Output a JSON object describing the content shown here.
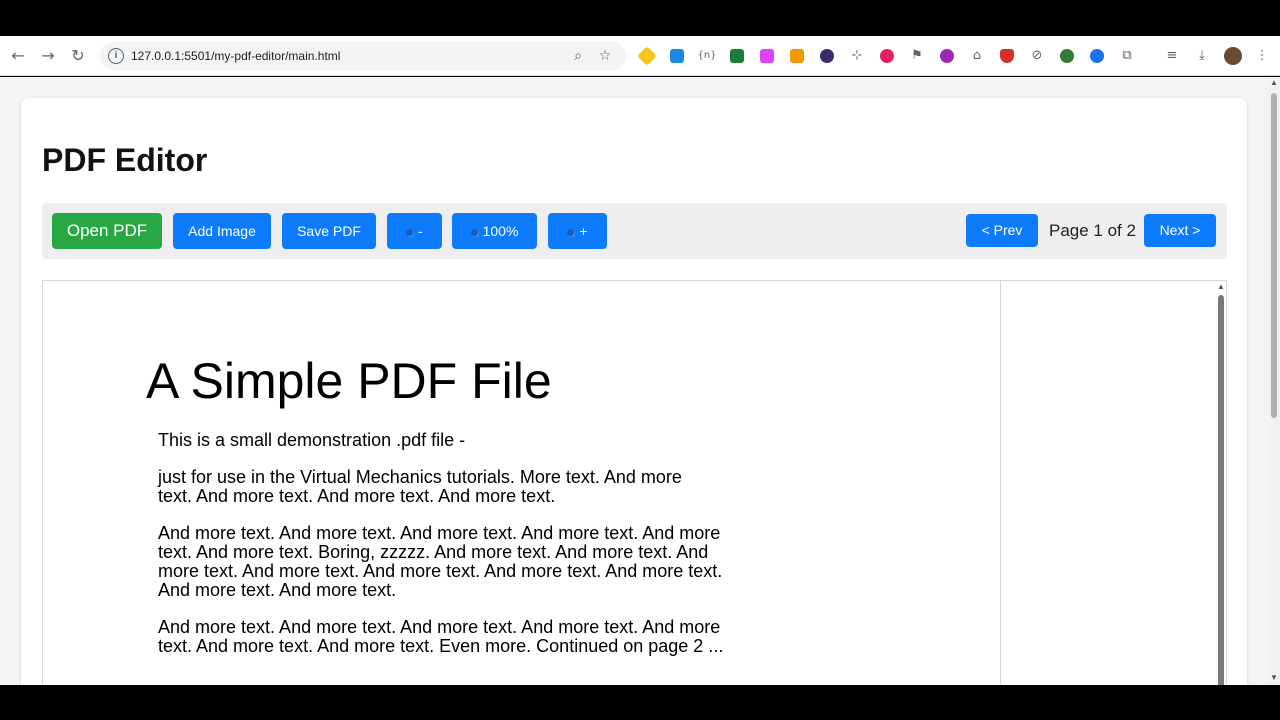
{
  "browser": {
    "url": "127.0.0.1:5501/my-pdf-editor/main.html",
    "nav_icons": [
      "back-arrow-icon",
      "forward-arrow-icon",
      "reload-icon"
    ],
    "omnibox_icons": [
      "site-info-icon",
      "zoom-icon",
      "bookmark-star-icon"
    ],
    "extension_colors": [
      "#f5c518",
      "#1e88e5",
      "#5f6368",
      "#188038",
      "#e040fb",
      "#f29900",
      "#7b1fa2",
      "#5f6368",
      "#e91e63",
      "#5f6368",
      "#9c27b0",
      "#5f6368",
      "#d93025",
      "#5f6368",
      "#2e7d32",
      "#1a73e8",
      "#5f6368"
    ],
    "menu_icons": [
      "reading-list-icon",
      "download-icon",
      "profile-avatar",
      "kebab-menu-icon"
    ]
  },
  "app": {
    "title": "PDF Editor",
    "buttons": {
      "open_pdf": "Open PDF",
      "add_image": "Add Image",
      "save_pdf": "Save PDF",
      "zoom_out": "-",
      "zoom_level": "100%",
      "zoom_in": "+",
      "prev": "< Prev",
      "next": "Next >"
    },
    "page_info": "Page 1 of 2",
    "colors": {
      "primary": "#0d7bff",
      "success": "#28a745",
      "controls_bg": "#eeeeee"
    }
  },
  "pdf": {
    "heading": "A Simple PDF File",
    "lines": [
      "This is a small demonstration .pdf file -",
      "just for use in the Virtual Mechanics tutorials. More text. And more",
      "text. And more text. And more text. And more text.",
      "And more text. And more text. And more text. And more text. And more",
      "text. And more text. Boring, zzzzz. And more text. And more text. And",
      "more text. And more text. And more text. And more text. And more text.",
      "And more text. And more text.",
      "And more text. And more text. And more text. And more text. And more",
      "text. And more text. And more text. Even more. Continued on page 2 ..."
    ]
  }
}
